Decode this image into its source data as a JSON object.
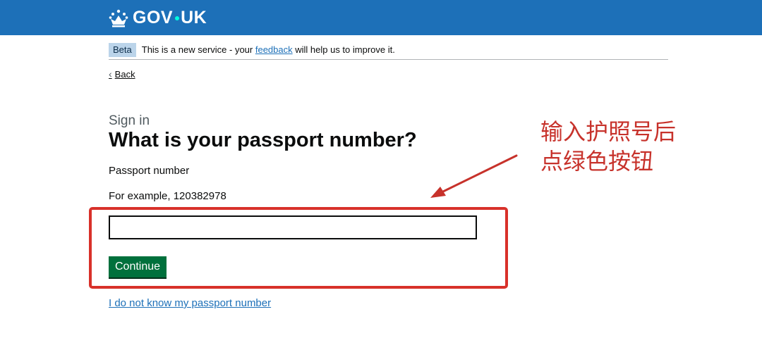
{
  "header": {
    "logo_text_left": "GOV",
    "logo_text_right": "UK"
  },
  "phase_banner": {
    "tag": "Beta",
    "text_before": "This is a new service - your ",
    "link": "feedback",
    "text_after": " will help us to improve it."
  },
  "back_link": "Back",
  "form": {
    "caption": "Sign in",
    "heading": "What is your passport number?",
    "label": "Passport number",
    "hint": "For example, 120382978",
    "input_value": "",
    "continue_button": "Continue",
    "alternative_link": "I do not know my passport number"
  },
  "annotation": {
    "line1": "输入护照号后",
    "line2": "点绿色按钮"
  },
  "colors": {
    "header_blue": "#1d70b8",
    "button_green": "#00703c",
    "annotation_red": "#d8312a",
    "link_blue": "#1d70b8"
  }
}
